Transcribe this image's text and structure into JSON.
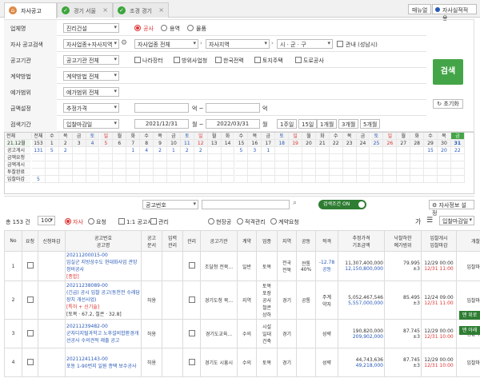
{
  "tabs": [
    {
      "label": "자사공고",
      "active": true
    },
    {
      "label": "경기 서울",
      "active": false
    },
    {
      "label": "조경 경기",
      "active": false
    }
  ],
  "top_right": {
    "manual": "매뉴얼",
    "performance": "자사실적적용"
  },
  "filters": {
    "type": {
      "label": "업체명",
      "value": "진리건설",
      "options": [
        "공사",
        "용역",
        "물품"
      ]
    },
    "category": {
      "label": "자사 공고검색",
      "sel1": "자사업종+자사지역",
      "sel2": "자사업종 전체",
      "sel3": "자사지역",
      "sel4": "시 · 군 · 구",
      "extra": "관내 (성남시)"
    },
    "agency": {
      "label": "공고기관",
      "value": "공고기관 전체",
      "options": [
        "나라장터",
        "방위사업청",
        "한국전력",
        "토지주택",
        "도로공사"
      ]
    },
    "contract": {
      "label": "계약방법",
      "value": "계약방법 전체"
    },
    "price_range": {
      "label": "예가범위",
      "value": "예가범위 전체"
    },
    "amount": {
      "label": "금액설정",
      "value": "추정가격",
      "unit1": "억 ~",
      "unit2": "억"
    },
    "period": {
      "label": "검색기간",
      "value": "입찰마감일",
      "from": "2021/12/31",
      "sep": "월 ~",
      "to": "2022/03/31",
      "sep2": "월",
      "buttons": [
        "1주일",
        "15일",
        "1개월",
        "3개월",
        "5개월"
      ]
    }
  },
  "search_label": "검색",
  "reset_label": "초기화",
  "calendar": {
    "headers": [
      "전체",
      "자사",
      "전체",
      "수",
      "목",
      "금",
      "토",
      "일",
      "월",
      "화",
      "수",
      "목",
      "금",
      "토",
      "일",
      "월",
      "화",
      "수",
      "목",
      "금",
      "토",
      "일",
      "월",
      "화",
      "수",
      "목",
      "금",
      "토",
      "일",
      "월",
      "화",
      "수",
      "목",
      "금"
    ],
    "month_label": "21.12월",
    "dates": [
      "153",
      "1",
      "2",
      "3",
      "4",
      "5",
      "6",
      "7",
      "8",
      "9",
      "10",
      "11",
      "12",
      "13",
      "14",
      "15",
      "16",
      "17",
      "18",
      "19",
      "20",
      "21",
      "22",
      "23",
      "24",
      "25",
      "26",
      "27",
      "28",
      "29",
      "30",
      "31"
    ],
    "rows": [
      {
        "label": "공고게시",
        "total": "131",
        "vals": [
          "5",
          "2",
          "",
          "",
          "",
          "",
          "1",
          "4",
          "2",
          "1",
          "2",
          "2",
          "",
          "",
          "5",
          "3",
          "1",
          "",
          "",
          "",
          "",
          "",
          "",
          "",
          "",
          "",
          "",
          "",
          "15",
          "20",
          "22",
          "21"
        ]
      },
      {
        "label": "금액요청",
        "total": "",
        "vals": []
      },
      {
        "label": "금액게시",
        "total": "",
        "vals": []
      },
      {
        "label": "투찰완료",
        "total": "",
        "vals": []
      },
      {
        "label": "입찰마감",
        "total": "5",
        "vals": []
      }
    ]
  },
  "notice_no_placeholder": "공고번호",
  "toggle_label": "검색조건 ON",
  "info_settings": "자사정보 설정",
  "list_bar": {
    "total": "총 153 건",
    "page_size": "100",
    "radios": [
      "자사",
      "요청"
    ],
    "checks": [
      "1:1 공고서",
      "관리"
    ],
    "radios2": [
      "현장공",
      "적격관리",
      "계약요청"
    ],
    "sort": "입찰마감일"
  },
  "columns": [
    "No",
    "요청",
    "신청마감",
    "공고번호\n공고명",
    "공고\n문서",
    "입력\n관리",
    "관리",
    "공고기관",
    "계약",
    "업종",
    "지역",
    "공동",
    "적격",
    "추정가격\n기초금액",
    "낙찰하한\n예가범위",
    "입찰개시\n입찰마감",
    "개찰"
  ],
  "rows": [
    {
      "no": "1",
      "id": "20211200015-00",
      "title": "임실군 지방상수도 현대화사업 관망정비공사",
      "tag": "[종합]",
      "doc": "",
      "agency": "조달청 전북...",
      "contract": "일반",
      "sector": "토목",
      "region": "전국\n전북",
      "joint": "전통\n40%",
      "grade": "-12.78\n공동",
      "price1": "11,307,400,000",
      "price2": "12,150,800,000",
      "rate1": "79.995",
      "rate2": "±3",
      "open": "12/29 00:00",
      "close": "12/31 11:00",
      "status": "입찰마감"
    },
    {
      "no": "2",
      "id": "20211238089-00",
      "title": "(긴급) 공시 입찰 공고(동천전 수래담장치 개선사업)",
      "tag": "[특허 + 신기술]",
      "extra": "[토목 · 67.2, 철콘 · 32.8]",
      "doc": "허용",
      "agency": "경기도청 북...",
      "contract": "지역",
      "sector": "토목\n포장\n공사\n철콘\n상하",
      "region": "경기",
      "joint": "공통",
      "grade": "주계\n약자",
      "price1": "5,052,467,546",
      "price2": "5,557,000,000",
      "rate1": "85.495",
      "rate2": "±3",
      "open": "12/24 09:00",
      "close": "12/31 11:00",
      "status": "입찰마감"
    },
    {
      "no": "3",
      "id": "20211239482-00",
      "title": "군자디지털과학고 노후설비합환경개선공사 수의견적 제출 공고",
      "tag": "",
      "doc": "허용",
      "agency": "경기도교육...",
      "contract": "수의",
      "sector": "시설\n일대\n건축",
      "region": "경기",
      "joint": "",
      "grade": "성략",
      "price1": "190,820,000",
      "price2": "209,902,000",
      "rate1": "87.745",
      "rate2": "±3",
      "open": "12/29 00:00",
      "close": "12/31 10:00",
      "status": "입찰마감"
    },
    {
      "no": "4",
      "id": "20211241143-00",
      "title": "포동 1-90번지 일원 종택 보수공사",
      "tag": "",
      "doc": "허용",
      "agency": "경기도 시흥시",
      "contract": "수의",
      "sector": "토목",
      "region": "경기",
      "joint": "",
      "grade": "성략",
      "price1": "44,743,636",
      "price2": "49,218,000",
      "rate1": "87.745",
      "rate2": "±3",
      "open": "12/29 00:00",
      "close": "12/31 10:00",
      "status": "입찰마감"
    }
  ],
  "float": [
    "맨 위로",
    "맨 아래"
  ]
}
